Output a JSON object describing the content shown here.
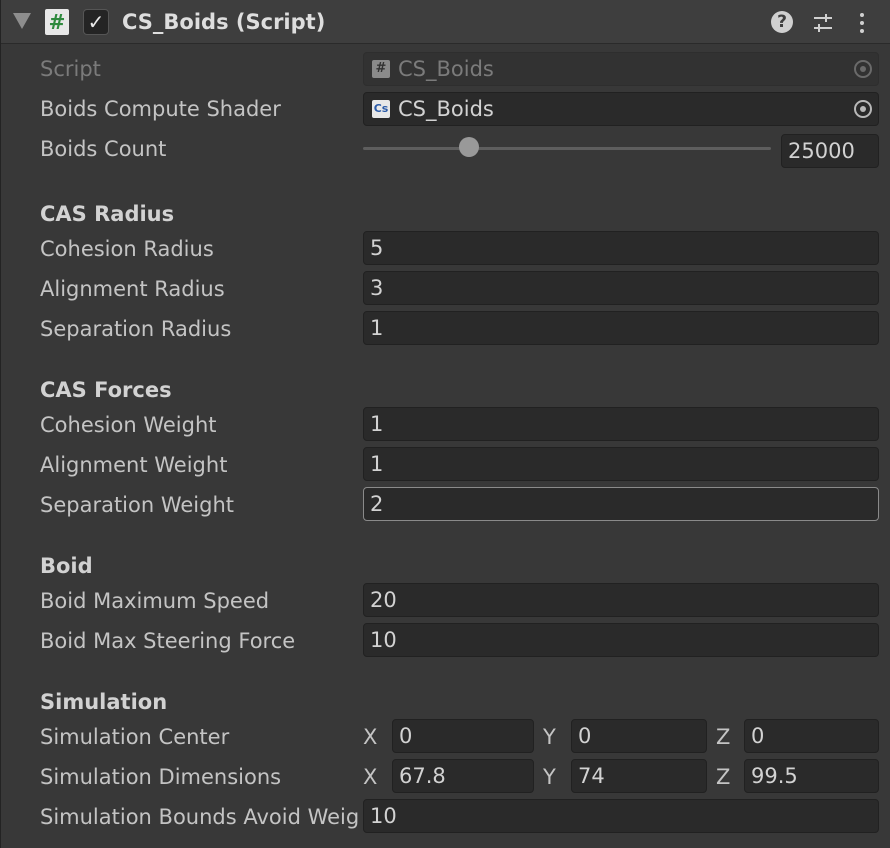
{
  "header": {
    "title": "CS_Boids (Script)",
    "script_icon_glyph": "#",
    "enabled_glyph": "✓",
    "help_glyph": "?"
  },
  "script_field": {
    "label": "Script",
    "value": "CS_Boids",
    "icon": "csharp-script-icon"
  },
  "compute_shader_field": {
    "label": "Boids Compute Shader",
    "value": "CS_Boids",
    "icon": "compute-shader-icon",
    "icon_glyph": "Cs"
  },
  "boids_count": {
    "label": "Boids Count",
    "value": "25000",
    "slider_fraction": 0.26
  },
  "cas_radius": {
    "heading": "CAS Radius",
    "cohesion": {
      "label": "Cohesion Radius",
      "value": "5"
    },
    "alignment": {
      "label": "Alignment Radius",
      "value": "3"
    },
    "separation": {
      "label": "Separation Radius",
      "value": "1"
    }
  },
  "cas_forces": {
    "heading": "CAS Forces",
    "cohesion": {
      "label": "Cohesion Weight",
      "value": "1"
    },
    "alignment": {
      "label": "Alignment Weight",
      "value": "1"
    },
    "separation": {
      "label": "Separation Weight",
      "value": "2"
    }
  },
  "boid": {
    "heading": "Boid",
    "max_speed": {
      "label": "Boid Maximum Speed",
      "value": "20"
    },
    "max_steering": {
      "label": "Boid Max Steering Force",
      "value": "10"
    }
  },
  "simulation": {
    "heading": "Simulation",
    "center": {
      "label": "Simulation Center",
      "x_label": "X",
      "y_label": "Y",
      "z_label": "Z",
      "x": "0",
      "y": "0",
      "z": "0"
    },
    "dimensions": {
      "label": "Simulation Dimensions",
      "x_label": "X",
      "y_label": "Y",
      "z_label": "Z",
      "x": "67.8",
      "y": "74",
      "z": "99.5"
    },
    "bounds_avoid": {
      "label": "Simulation Bounds Avoid Weight",
      "value": "10"
    }
  },
  "colors": {
    "background": "#383838",
    "header": "#3e3e3e",
    "field": "#2a2a2a",
    "text": "#c4c4c4",
    "script_hash": "#2f8a3e"
  }
}
